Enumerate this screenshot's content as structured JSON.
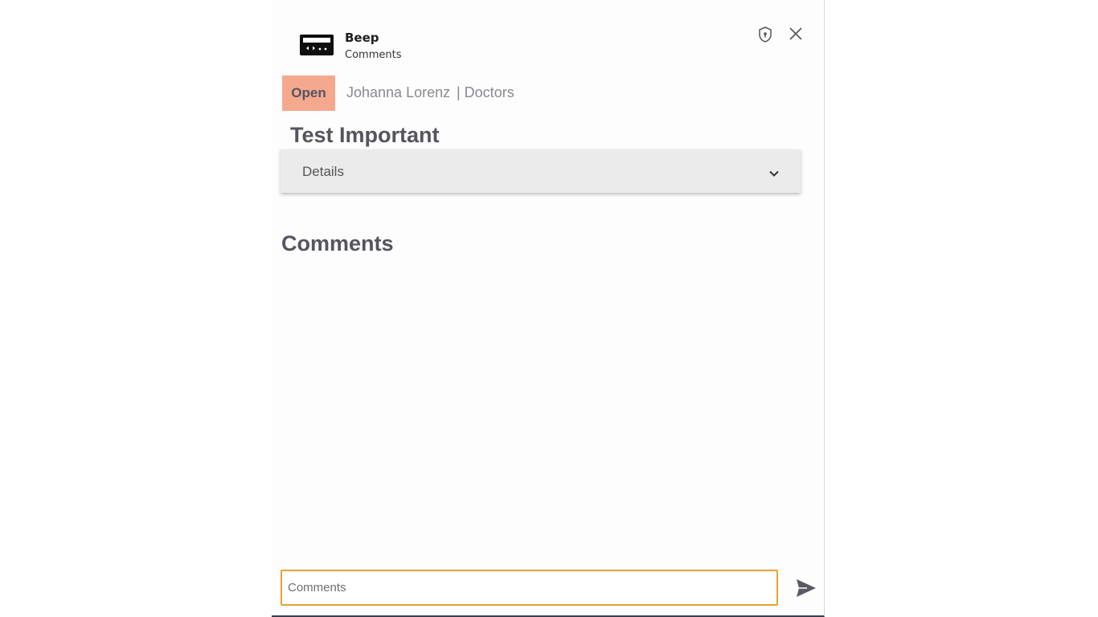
{
  "header": {
    "app_name": "Beep",
    "subtitle": "Comments",
    "app_icon": "pager-icon",
    "actions": [
      "shield-icon",
      "close-icon"
    ]
  },
  "ticket": {
    "status": "Open",
    "status_color": "#f4a98f",
    "assignee": "Johanna Lorenz",
    "group": "| Doctors",
    "title": "Test Important"
  },
  "details": {
    "label": "Details",
    "icon": "chevron-down-icon"
  },
  "comments": {
    "heading": "Comments",
    "input_placeholder": "Comments",
    "input_value": "",
    "input_border_color": "#e8a234",
    "send_icon": "send-icon"
  }
}
